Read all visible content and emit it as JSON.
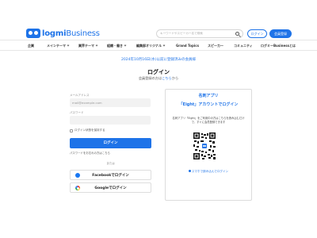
{
  "header": {
    "logo_brand": "logmi",
    "logo_suffix": "Business",
    "search_placeholder": "キーワードやスピーカー名で検索",
    "login_label": "ログイン",
    "register_label": "会員登録"
  },
  "nav": {
    "items": [
      "企業",
      "メインテーマ",
      "業界テーマ",
      "組織・働き",
      "編集部オリジナル",
      "Grand Topics",
      "スピーカー",
      "コミュニティ",
      "ログミーBusinessとは"
    ]
  },
  "announcement": "2024年10月16日(水)以前に登録済みの会員様",
  "login": {
    "title": "ログイン",
    "subtitle_prefix": "会員登録の方は",
    "subtitle_link": "こちら",
    "subtitle_suffix": "から",
    "email_label": "メールアドレス",
    "email_placeholder": "mail@example.com",
    "password_label": "パスワード",
    "password_placeholder": "",
    "remember_label": "ログイン状態を保持する",
    "submit_label": "ログイン",
    "forgot_label": "パスワードをお忘れの方はこちら",
    "divider_label": "または",
    "facebook_label": "Facebookでログイン",
    "google_label": "Googleでログイン"
  },
  "eight": {
    "title_line1": "名刺アプリ",
    "title_line2": "「Eight」アカウントでログイン",
    "description": "名刺アプリ「Eight」をご利用中の方はこちらを読み込むだけで、すぐに会員登録できます",
    "app_link_text": "スマホで読み込んでログイン"
  },
  "colors": {
    "accent": "#1e73e8"
  }
}
